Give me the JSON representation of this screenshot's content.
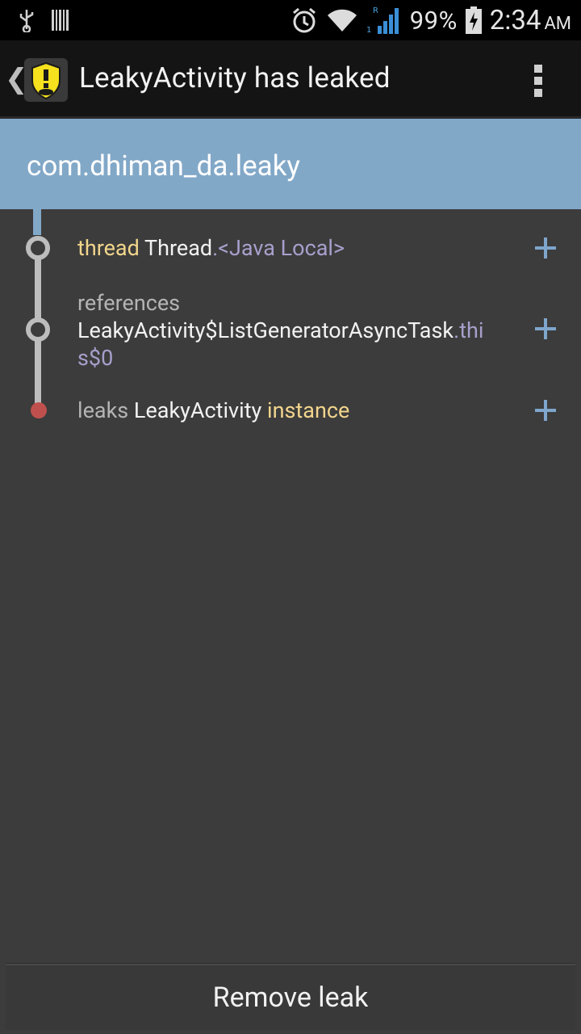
{
  "status_bar": {
    "battery": "99%",
    "time": "2:34",
    "ampm": "AM",
    "icons": [
      "usb-icon",
      "barcode-icon",
      "alarm-icon",
      "wifi-icon",
      "signal-icon",
      "battery-charging-icon"
    ]
  },
  "action_bar": {
    "title": "LeakyActivity has leaked"
  },
  "header": {
    "package": "com.dhiman_da.leaky"
  },
  "trace": [
    {
      "prefix": "thread",
      "name": "Thread",
      "suffix": ".<Java Local>"
    },
    {
      "prefix": "references",
      "name": "LeakyActivity$ListGeneratorAsyncTask",
      "suffix_line1": ".thi",
      "suffix_line2": "s$0"
    },
    {
      "prefix": "leaks",
      "name": "LeakyActivity",
      "suffix": "instance"
    }
  ],
  "colors": {
    "header": "#82a8c8",
    "background": "#3c3c3c",
    "accent_plus": "#7fa6cc",
    "keyword_yellow": "#f1d58c",
    "field_purple": "#a89fcc",
    "leak_dot": "#c0504d"
  },
  "button": {
    "label": "Remove leak"
  }
}
